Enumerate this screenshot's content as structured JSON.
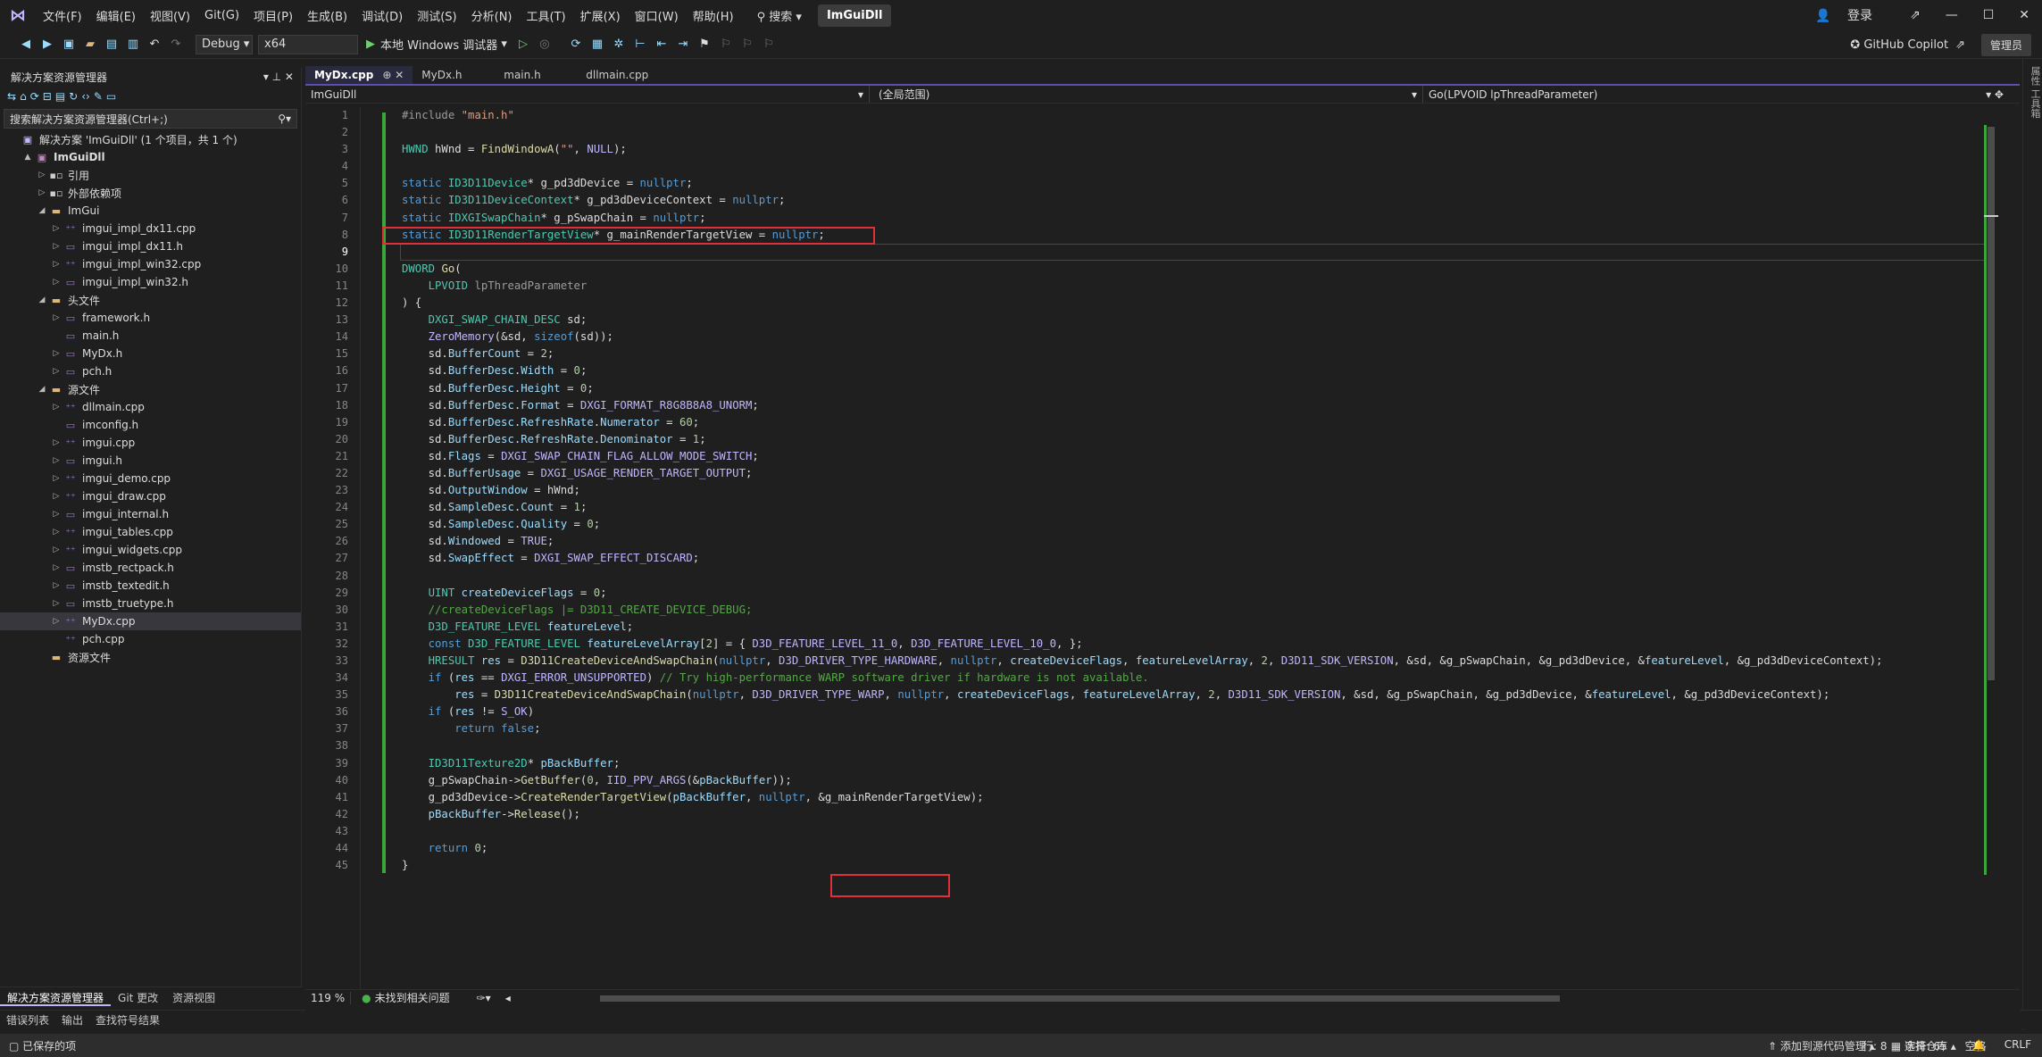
{
  "title_bar": {
    "menu": [
      "文件(F)",
      "编辑(E)",
      "视图(V)",
      "Git(G)",
      "项目(P)",
      "生成(B)",
      "调试(D)",
      "测试(S)",
      "分析(N)",
      "工具(T)",
      "扩展(X)",
      "窗口(W)",
      "帮助(H)"
    ],
    "search": "搜索",
    "solution_name": "ImGuiDll",
    "login": "登录"
  },
  "toolbar": {
    "config": "Debug",
    "platform": "x64",
    "run_label": "本地 Windows 调试器",
    "copilot": "GitHub Copilot",
    "admin": "管理员"
  },
  "right_strip": "属性  工具箱",
  "solution_explorer": {
    "title": "解决方案资源管理器",
    "search_placeholder": "搜索解决方案资源管理器(Ctrl+;)",
    "tree": [
      {
        "label": "解决方案 'ImGuiDll' (1 个项目，共 1 个)",
        "indent": 0,
        "icon": "sol",
        "arrow": ""
      },
      {
        "label": "ImGuiDll",
        "indent": 1,
        "icon": "proj",
        "arrow": "▲",
        "bold": true
      },
      {
        "label": "引用",
        "indent": 2,
        "icon": "ref",
        "arrow": "▷"
      },
      {
        "label": "外部依赖项",
        "indent": 2,
        "icon": "ref",
        "arrow": "▷"
      },
      {
        "label": "ImGui",
        "indent": 2,
        "icon": "folder",
        "arrow": "◢"
      },
      {
        "label": "imgui_impl_dx11.cpp",
        "indent": 3,
        "icon": "cpp",
        "arrow": "▷"
      },
      {
        "label": "imgui_impl_dx11.h",
        "indent": 3,
        "icon": "h",
        "arrow": "▷"
      },
      {
        "label": "imgui_impl_win32.cpp",
        "indent": 3,
        "icon": "cpp",
        "arrow": "▷"
      },
      {
        "label": "imgui_impl_win32.h",
        "indent": 3,
        "icon": "h",
        "arrow": "▷"
      },
      {
        "label": "头文件",
        "indent": 2,
        "icon": "folder",
        "arrow": "◢"
      },
      {
        "label": "framework.h",
        "indent": 3,
        "icon": "h",
        "arrow": "▷"
      },
      {
        "label": "main.h",
        "indent": 3,
        "icon": "h",
        "arrow": ""
      },
      {
        "label": "MyDx.h",
        "indent": 3,
        "icon": "h",
        "arrow": "▷"
      },
      {
        "label": "pch.h",
        "indent": 3,
        "icon": "h",
        "arrow": "▷"
      },
      {
        "label": "源文件",
        "indent": 2,
        "icon": "folder",
        "arrow": "◢"
      },
      {
        "label": "dllmain.cpp",
        "indent": 3,
        "icon": "cpp",
        "arrow": "▷"
      },
      {
        "label": "imconfig.h",
        "indent": 3,
        "icon": "h",
        "arrow": ""
      },
      {
        "label": "imgui.cpp",
        "indent": 3,
        "icon": "cpp",
        "arrow": "▷"
      },
      {
        "label": "imgui.h",
        "indent": 3,
        "icon": "h",
        "arrow": "▷"
      },
      {
        "label": "imgui_demo.cpp",
        "indent": 3,
        "icon": "cpp",
        "arrow": "▷"
      },
      {
        "label": "imgui_draw.cpp",
        "indent": 3,
        "icon": "cpp",
        "arrow": "▷"
      },
      {
        "label": "imgui_internal.h",
        "indent": 3,
        "icon": "h",
        "arrow": "▷"
      },
      {
        "label": "imgui_tables.cpp",
        "indent": 3,
        "icon": "cpp",
        "arrow": "▷"
      },
      {
        "label": "imgui_widgets.cpp",
        "indent": 3,
        "icon": "cpp",
        "arrow": "▷"
      },
      {
        "label": "imstb_rectpack.h",
        "indent": 3,
        "icon": "h",
        "arrow": "▷"
      },
      {
        "label": "imstb_textedit.h",
        "indent": 3,
        "icon": "h",
        "arrow": "▷"
      },
      {
        "label": "imstb_truetype.h",
        "indent": 3,
        "icon": "h",
        "arrow": "▷"
      },
      {
        "label": "MyDx.cpp",
        "indent": 3,
        "icon": "cpp",
        "arrow": "▷",
        "selected": true
      },
      {
        "label": "pch.cpp",
        "indent": 3,
        "icon": "cpp",
        "arrow": ""
      },
      {
        "label": "资源文件",
        "indent": 2,
        "icon": "folder",
        "arrow": ""
      }
    ],
    "bottom_tabs": [
      "解决方案资源管理器",
      "Git 更改",
      "资源视图"
    ]
  },
  "editor": {
    "tabs": [
      {
        "label": "MyDx.cpp",
        "active": true
      },
      {
        "label": "MyDx.h"
      },
      {
        "label": "main.h"
      },
      {
        "label": "dllmain.cpp"
      }
    ],
    "nav": {
      "project": "ImGuiDll",
      "scope": "(全局范围)",
      "member": "Go(LPVOID lpThreadParameter)"
    },
    "current_line": 9,
    "zoom": "119 %",
    "issues": "未找到相关问题"
  },
  "output_tabs": [
    "错误列表",
    "输出",
    "查找符号结果"
  ],
  "status": {
    "left": "已保存的项",
    "line": "行: 8",
    "col": "字符: 65",
    "ws": "空格",
    "eol": "CRLF",
    "add_source": "添加到源代码管理",
    "repo": "选择仓库"
  }
}
